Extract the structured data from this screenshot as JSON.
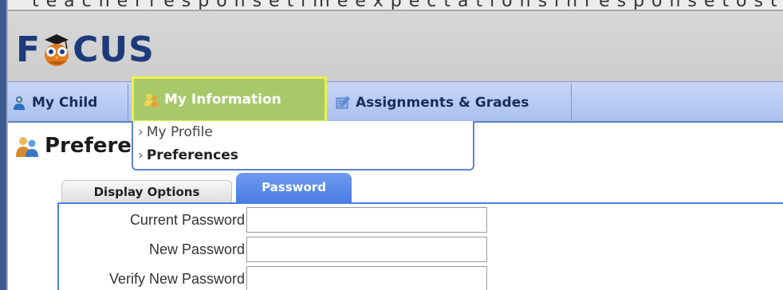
{
  "app": {
    "logo_text_left": "F",
    "logo_text_right": "CUS",
    "top_strip_text": "t e a c h e r    r e s p o n s e    t i m e    e x p e c t a t i o n s    i n    r e s p o n s e    t o    s t u d e n t    i n q u i r y"
  },
  "nav": {
    "my_child": "My Child",
    "my_information": "My Information",
    "assignments_grades": "Assignments & Grades"
  },
  "page": {
    "title": "Prefere"
  },
  "dropdown": {
    "my_profile": "My Profile",
    "preferences": "Preferences",
    "caret": "›"
  },
  "tabs": {
    "display_options": "Display Options",
    "password": "Password"
  },
  "form": {
    "current_password_label": "Current Password",
    "new_password_label": "New Password",
    "verify_password_label": "Verify New Password",
    "current_password_value": "",
    "new_password_value": "",
    "verify_password_value": ""
  },
  "colors": {
    "brand_blue": "#1d3b7c",
    "nav_bg": "#a9c0ee",
    "highlight": "#ecf04a",
    "active_tab": "#4a7de3"
  }
}
